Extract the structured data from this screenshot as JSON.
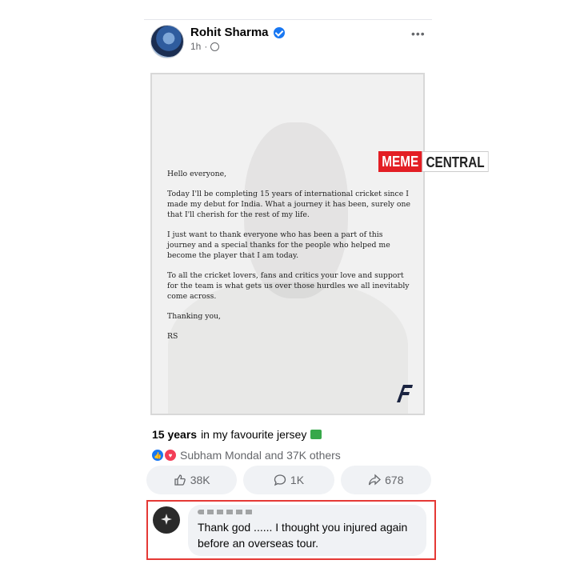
{
  "post": {
    "author": "Rohit Sharma",
    "time": "1h",
    "time_separator": "·",
    "more_label": "•••"
  },
  "letter": {
    "greeting": "Hello everyone,",
    "paragraph1": "Today I'll be completing 15 years of international cricket since I made my debut for India. What a journey it has been, surely one that I'll cherish for the rest of my life.",
    "paragraph2": "I just want to thank everyone who has been a part of this journey and a special thanks for the people who helped me become the player that I am today.",
    "paragraph3": "To all the cricket lovers, fans and critics your love and support for the team is what gets us over those hurdles we all inevitably come across.",
    "closing": "Thanking you,",
    "signature": "RS"
  },
  "watermark": {
    "part1": "MEME",
    "part2": "CENTRAL"
  },
  "caption": {
    "bold": "15 years",
    "rest": "in my favourite jersey"
  },
  "reactions": {
    "summary": "Subham Mondal and 37K others"
  },
  "actions": [
    {
      "label": "38K",
      "icon": "like-icon"
    },
    {
      "label": "1K",
      "icon": "comment-icon"
    },
    {
      "label": "678",
      "icon": "share-icon"
    }
  ],
  "comment": {
    "text": "Thank god ...... I thought you injured again before an overseas tour."
  },
  "colors": {
    "accent": "#1877f2",
    "love": "#f33e58",
    "highlight_border": "#e53935",
    "watermark_red": "#e31e24"
  }
}
